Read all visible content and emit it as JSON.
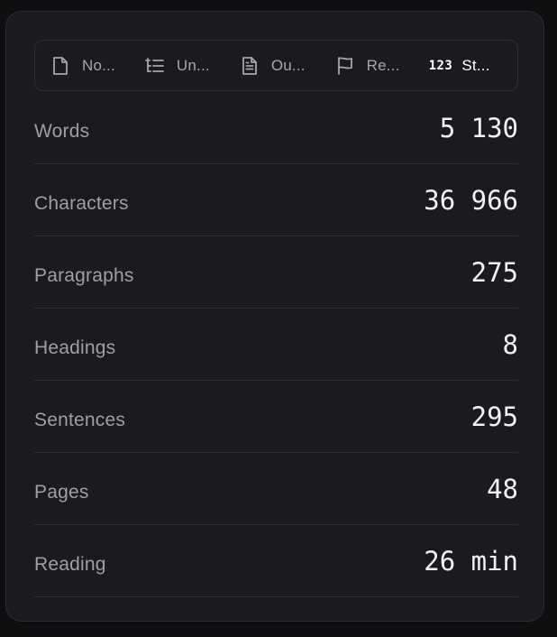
{
  "tabs": [
    {
      "label": "No...",
      "icon": "file-icon",
      "active": false
    },
    {
      "label": "Un...",
      "icon": "outline-list-icon",
      "active": false
    },
    {
      "label": "Ou...",
      "icon": "document-text-icon",
      "active": false
    },
    {
      "label": "Re...",
      "icon": "flag-icon",
      "active": false
    },
    {
      "label": "St...",
      "icon_text": "123",
      "icon": "numbers-icon",
      "active": true
    }
  ],
  "stats": [
    {
      "label": "Words",
      "value": "5 130"
    },
    {
      "label": "Characters",
      "value": "36 966"
    },
    {
      "label": "Paragraphs",
      "value": "275"
    },
    {
      "label": "Headings",
      "value": "8"
    },
    {
      "label": "Sentences",
      "value": "295"
    },
    {
      "label": "Pages",
      "value": "48"
    },
    {
      "label": "Reading",
      "value": "26 min"
    }
  ],
  "colors": {
    "background": "#0f0f11",
    "panel": "#1b1b1f",
    "divider": "#2e2e34",
    "label": "#9e9ea4",
    "value": "#f2f2f2",
    "tab_inactive": "#a6a6ab"
  }
}
